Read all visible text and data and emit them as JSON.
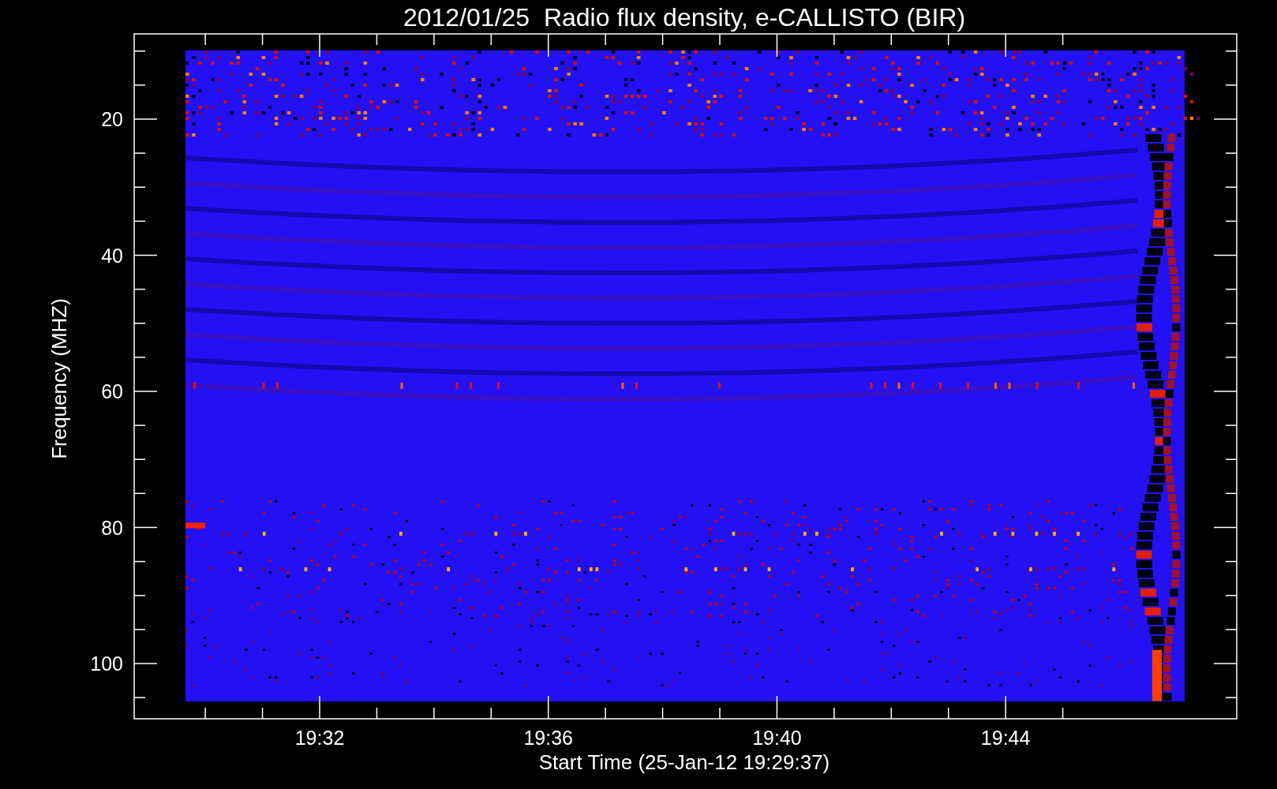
{
  "title": "2012/01/25  Radio flux density, e-CALLISTO (BIR)",
  "y_axis": {
    "label": "Frequency (MHZ)",
    "ticks": [
      "20",
      "40",
      "60",
      "80",
      "100"
    ]
  },
  "x_axis": {
    "label": "Start Time (25-Jan-12 19:29:37)",
    "ticks": [
      "19:32",
      "19:36",
      "19:40",
      "19:44"
    ]
  }
}
